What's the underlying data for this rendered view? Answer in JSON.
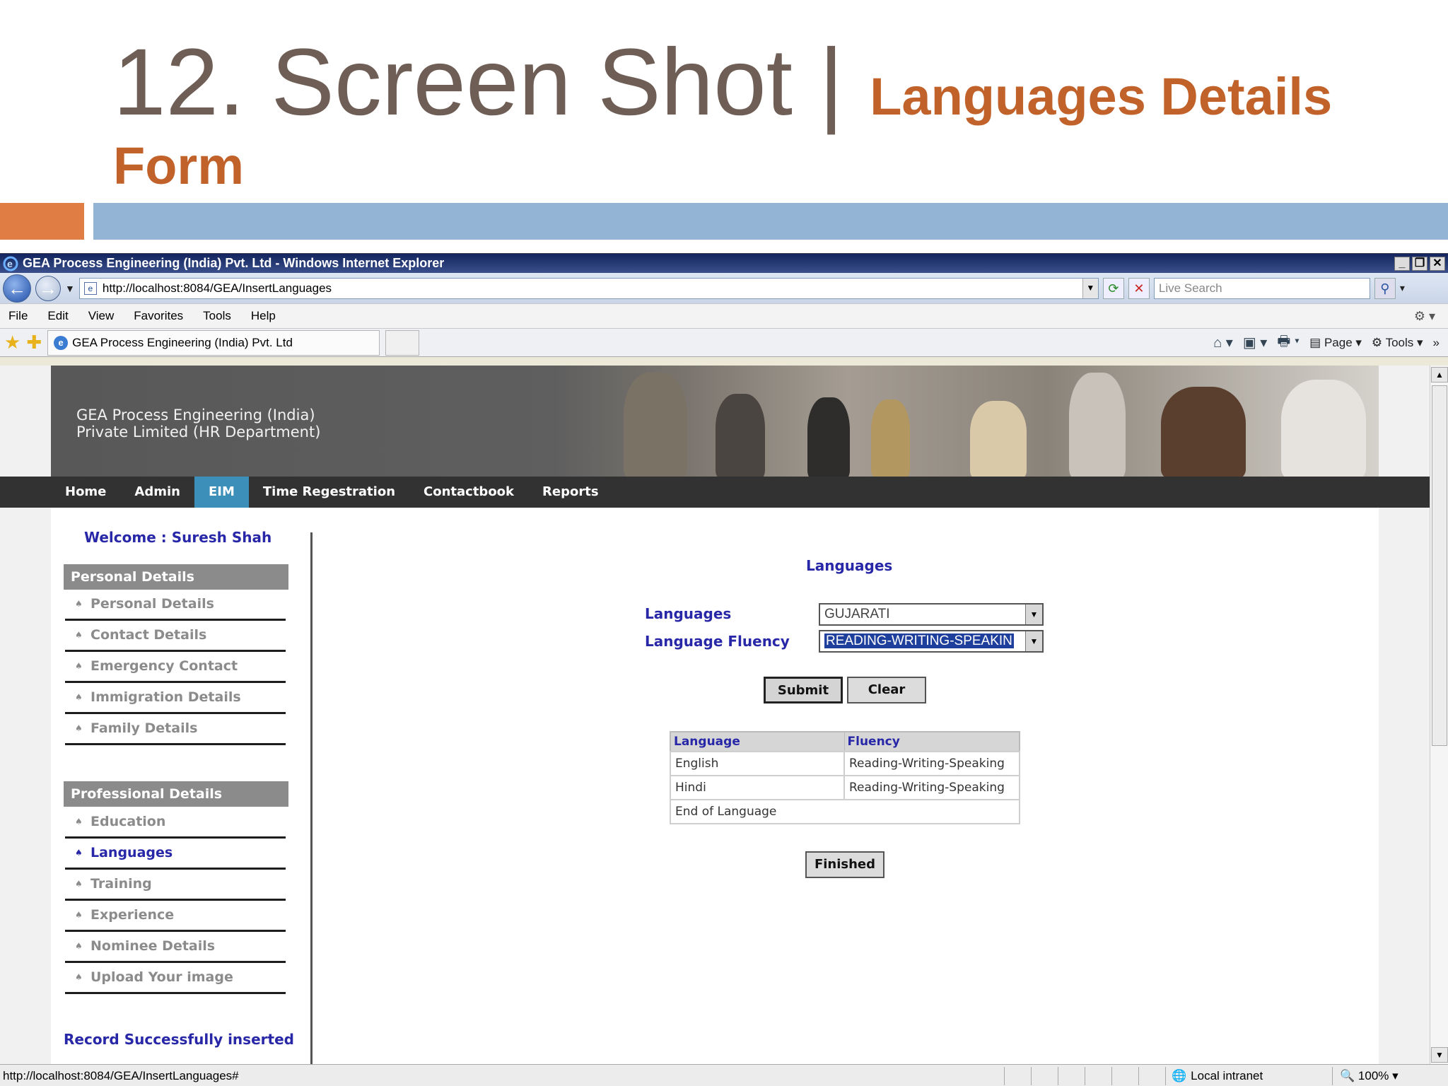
{
  "slide": {
    "title_main": "12. Screen Shot | ",
    "title_sub_part1": "Languages Details",
    "title_sub_part2": "Form"
  },
  "browser": {
    "window_title": "GEA Process Engineering (India) Pvt. Ltd - Windows Internet Explorer",
    "address": "http://localhost:8084/GEA/InsertLanguages",
    "search_placeholder": "Live Search",
    "menu": [
      "File",
      "Edit",
      "View",
      "Favorites",
      "Tools",
      "Help"
    ],
    "tab_title": "GEA Process Engineering (India) Pvt. Ltd",
    "cmd_page": "Page",
    "cmd_tools": "Tools",
    "status_url": "http://localhost:8084/GEA/InsertLanguages#",
    "status_zone": "Local intranet",
    "zoom": "100%"
  },
  "site": {
    "brand_line1": "GEA Process Engineering (India)",
    "brand_line2": "Private Limited (HR Department)",
    "nav": [
      "Home",
      "Admin",
      "EIM",
      "Time Regestration",
      "Contactbook",
      "Reports"
    ],
    "nav_active": "EIM",
    "welcome": "Welcome : Suresh Shah",
    "personal_head": "Personal Details",
    "personal_items": [
      "Personal Details",
      "Contact Details",
      "Emergency Contact",
      "Immigration Details",
      "Family Details"
    ],
    "professional_head": "Professional Details",
    "professional_items": [
      "Education",
      "Languages",
      "Training",
      "Experience",
      "Nominee Details",
      "Upload Your image"
    ],
    "active_item": "Languages",
    "record_msg": "Record Successfully inserted"
  },
  "form": {
    "title": "Languages",
    "language_label": "Languages",
    "language_value": "GUJARATI",
    "fluency_label": "Language Fluency",
    "fluency_value": "READING-WRITING-SPEAKIN",
    "submit_label": "Submit",
    "clear_label": "Clear",
    "finished_label": "Finished"
  },
  "table": {
    "headers": [
      "Language",
      "Fluency"
    ],
    "rows": [
      [
        "English",
        "Reading-Writing-Speaking"
      ],
      [
        "Hindi",
        "Reading-Writing-Speaking"
      ]
    ],
    "footer": "End of Language"
  },
  "colors": {
    "accent_orange": "#c0622a",
    "bar_blue": "#93b4d4",
    "nav_active": "#3c8fb9",
    "link_blue": "#2727a8"
  }
}
